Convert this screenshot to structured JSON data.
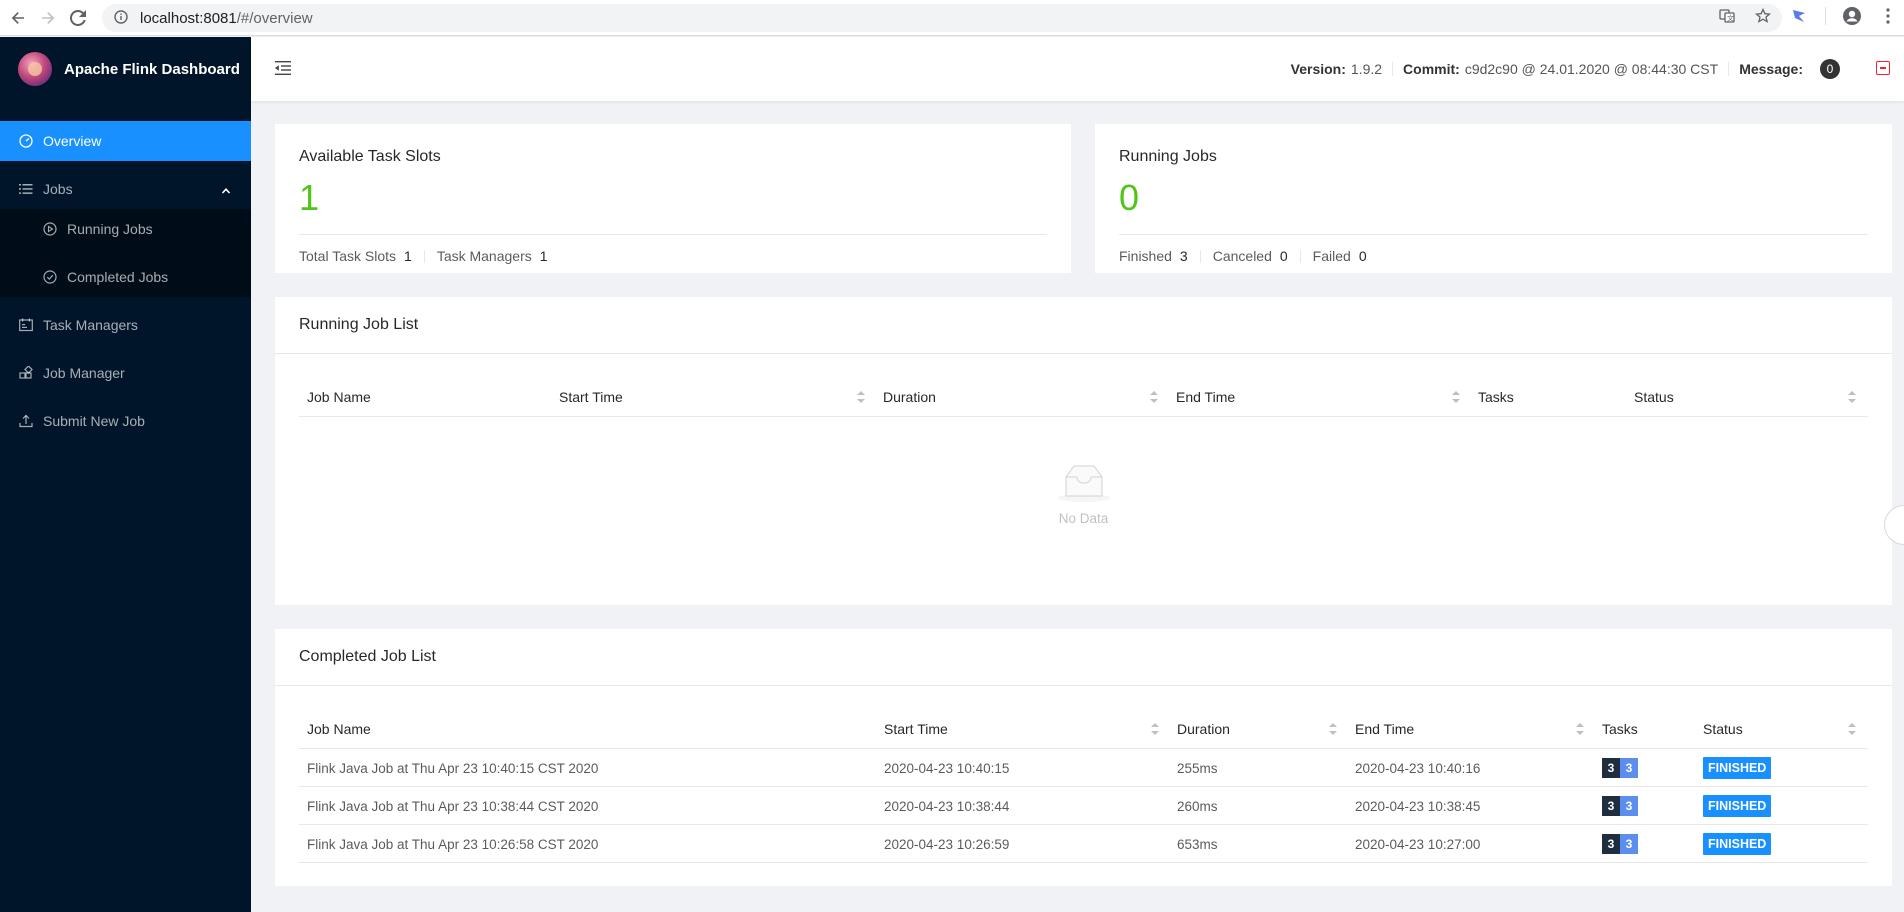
{
  "browser": {
    "url_host": "localhost:8081",
    "url_path": "/#/overview",
    "icons": [
      "back-icon",
      "forward-icon",
      "reload-icon",
      "info-icon",
      "translate-icon",
      "star-icon",
      "extension-icon",
      "account-icon",
      "menu-dots-icon"
    ]
  },
  "sidebar": {
    "title": "Apache Flink Dashboard",
    "items": [
      {
        "label": "Overview",
        "icon": "dashboard-icon",
        "selected": true
      },
      {
        "label": "Jobs",
        "icon": "list-icon",
        "expanded": true
      },
      {
        "label": "Running Jobs",
        "icon": "play-circle-icon",
        "sub": true
      },
      {
        "label": "Completed Jobs",
        "icon": "check-circle-icon",
        "sub": true
      },
      {
        "label": "Task Managers",
        "icon": "schedule-icon"
      },
      {
        "label": "Job Manager",
        "icon": "build-icon"
      },
      {
        "label": "Submit New Job",
        "icon": "upload-icon"
      }
    ]
  },
  "header": {
    "version_label": "Version:",
    "version_value": "1.9.2",
    "commit_label": "Commit:",
    "commit_value": "c9d2c90 @ 24.01.2020 @ 08:44:30 CST",
    "message_label": "Message:",
    "message_count": "0"
  },
  "slots_card": {
    "title": "Available Task Slots",
    "value": "1",
    "total_label": "Total Task Slots",
    "total_value": "1",
    "tm_label": "Task Managers",
    "tm_value": "1"
  },
  "running_card": {
    "title": "Running Jobs",
    "value": "0",
    "finished_label": "Finished",
    "finished_value": "3",
    "canceled_label": "Canceled",
    "canceled_value": "0",
    "failed_label": "Failed",
    "failed_value": "0"
  },
  "running_list": {
    "title": "Running Job List",
    "columns": [
      "Job Name",
      "Start Time",
      "Duration",
      "End Time",
      "Tasks",
      "Status"
    ],
    "empty_text": "No Data"
  },
  "completed_list": {
    "title": "Completed Job List",
    "columns": [
      "Job Name",
      "Start Time",
      "Duration",
      "End Time",
      "Tasks",
      "Status"
    ],
    "rows": [
      {
        "name": "Flink Java Job at Thu Apr 23 10:40:15 CST 2020",
        "start": "2020-04-23 10:40:15",
        "duration": "255ms",
        "end": "2020-04-23 10:40:16",
        "tasks_total": "3",
        "tasks_finished": "3",
        "status": "FINISHED"
      },
      {
        "name": "Flink Java Job at Thu Apr 23 10:38:44 CST 2020",
        "start": "2020-04-23 10:38:44",
        "duration": "260ms",
        "end": "2020-04-23 10:38:45",
        "tasks_total": "3",
        "tasks_finished": "3",
        "status": "FINISHED"
      },
      {
        "name": "Flink Java Job at Thu Apr 23 10:26:58 CST 2020",
        "start": "2020-04-23 10:26:59",
        "duration": "653ms",
        "end": "2020-04-23 10:27:00",
        "tasks_total": "3",
        "tasks_finished": "3",
        "status": "FINISHED"
      }
    ]
  },
  "colors": {
    "sidebar_bg": "#001529",
    "selected": "#1890ff",
    "stat_green": "#52c41a",
    "finished_tag": "#1890ff"
  }
}
